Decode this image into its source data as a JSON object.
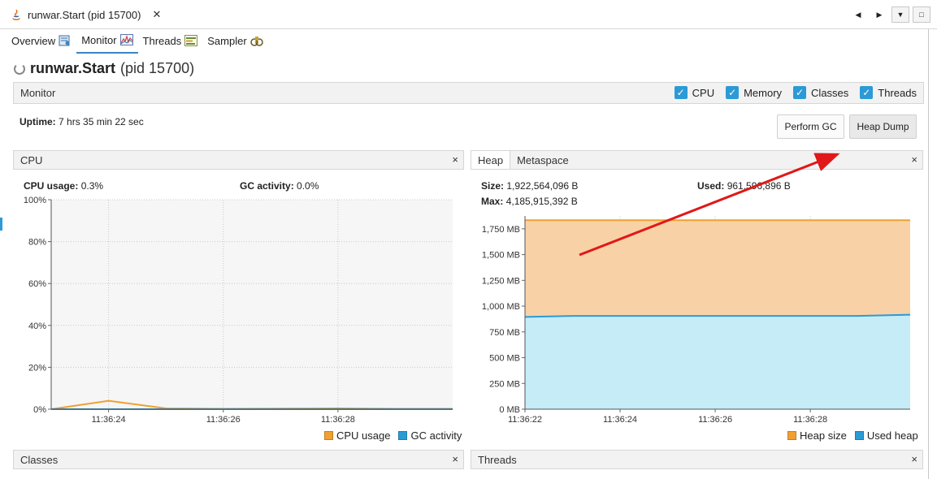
{
  "doc_tab": {
    "title": "runwar.Start (pid 15700)"
  },
  "nav": {
    "prev": "◀",
    "next": "▶",
    "menu": "▼",
    "maximize": "□"
  },
  "view_tabs": [
    {
      "label": "Overview",
      "icon": "overview-icon"
    },
    {
      "label": "Monitor",
      "icon": "monitor-icon"
    },
    {
      "label": "Threads",
      "icon": "threads-icon"
    },
    {
      "label": "Sampler",
      "icon": "sampler-icon"
    }
  ],
  "page": {
    "title_bold": "runwar.Start",
    "title_rest": "(pid 15700)"
  },
  "monitor": {
    "title": "Monitor",
    "checks": [
      {
        "label": "CPU",
        "checked": true
      },
      {
        "label": "Memory",
        "checked": true
      },
      {
        "label": "Classes",
        "checked": true
      },
      {
        "label": "Threads",
        "checked": true
      }
    ],
    "uptime_label": "Uptime:",
    "uptime_value": "7 hrs 35 min 22 sec",
    "perform_gc": "Perform GC",
    "heap_dump": "Heap Dump"
  },
  "cpu_panel": {
    "title": "CPU",
    "close": "×",
    "usage_label": "CPU usage:",
    "usage_value": "0.3%",
    "gc_label": "GC activity:",
    "gc_value": "0.0%",
    "legend": [
      {
        "label": "CPU usage",
        "color": "#f0a030"
      },
      {
        "label": "GC activity",
        "color": "#2c9ad6"
      }
    ]
  },
  "heap_panel": {
    "tabs": [
      "Heap",
      "Metaspace"
    ],
    "close": "×",
    "size_label": "Size:",
    "size_value": "1,922,564,096 B",
    "used_label": "Used:",
    "used_value": "961,596,896 B",
    "max_label": "Max:",
    "max_value": "4,185,915,392 B",
    "legend": [
      {
        "label": "Heap size",
        "color": "#f0a030"
      },
      {
        "label": "Used heap",
        "color": "#2c9ad6"
      }
    ]
  },
  "classes_panel": {
    "title": "Classes",
    "close": "×"
  },
  "threads_panel": {
    "title": "Threads",
    "close": "×"
  },
  "chart_data": [
    {
      "type": "line",
      "ylim": [
        0,
        100
      ],
      "y_ticks": [
        "0%",
        "20%",
        "40%",
        "60%",
        "80%",
        "100%"
      ],
      "x_tick_labels": [
        "11:36:24",
        "11:36:26",
        "11:36:28"
      ],
      "x_range_s": [
        23.0,
        30.0
      ],
      "x_ticks_s": [
        24,
        26,
        28
      ],
      "grid": true,
      "legend": "bottom-right",
      "series": [
        {
          "name": "CPU usage",
          "color": "#f0a030",
          "x_s": [
            23.0,
            24.0,
            25.0,
            26.0,
            27.0,
            28.0,
            29.0,
            30.0
          ],
          "values": [
            0,
            4,
            0.4,
            0.2,
            0.3,
            0.4,
            0.2,
            0.2
          ]
        },
        {
          "name": "GC activity",
          "color": "#2c9ad6",
          "x_s": [
            23.0,
            30.0
          ],
          "values": [
            0,
            0
          ]
        }
      ]
    },
    {
      "type": "area",
      "ylim": [
        0,
        1875
      ],
      "y_ticks": [
        "0 MB",
        "250 MB",
        "500 MB",
        "750 MB",
        "1,000 MB",
        "1,250 MB",
        "1,500 MB",
        "1,750 MB"
      ],
      "x_tick_labels": [
        "11:36:22",
        "11:36:24",
        "11:36:26",
        "11:36:28"
      ],
      "x_range_s": [
        22.0,
        30.1
      ],
      "x_ticks_s": [
        22,
        24,
        26,
        28
      ],
      "grid": true,
      "legend": "bottom-right",
      "series": [
        {
          "name": "Heap size",
          "color": "#f0a030",
          "x_s": [
            22.0,
            30.1
          ],
          "values": [
            1834,
            1834
          ]
        },
        {
          "name": "Used heap",
          "color": "#2c9ad6",
          "x_s": [
            22.0,
            23.0,
            24.0,
            26.0,
            28.0,
            29.0,
            30.1
          ],
          "values": [
            895,
            905,
            905,
            905,
            905,
            905,
            917
          ]
        }
      ]
    }
  ]
}
